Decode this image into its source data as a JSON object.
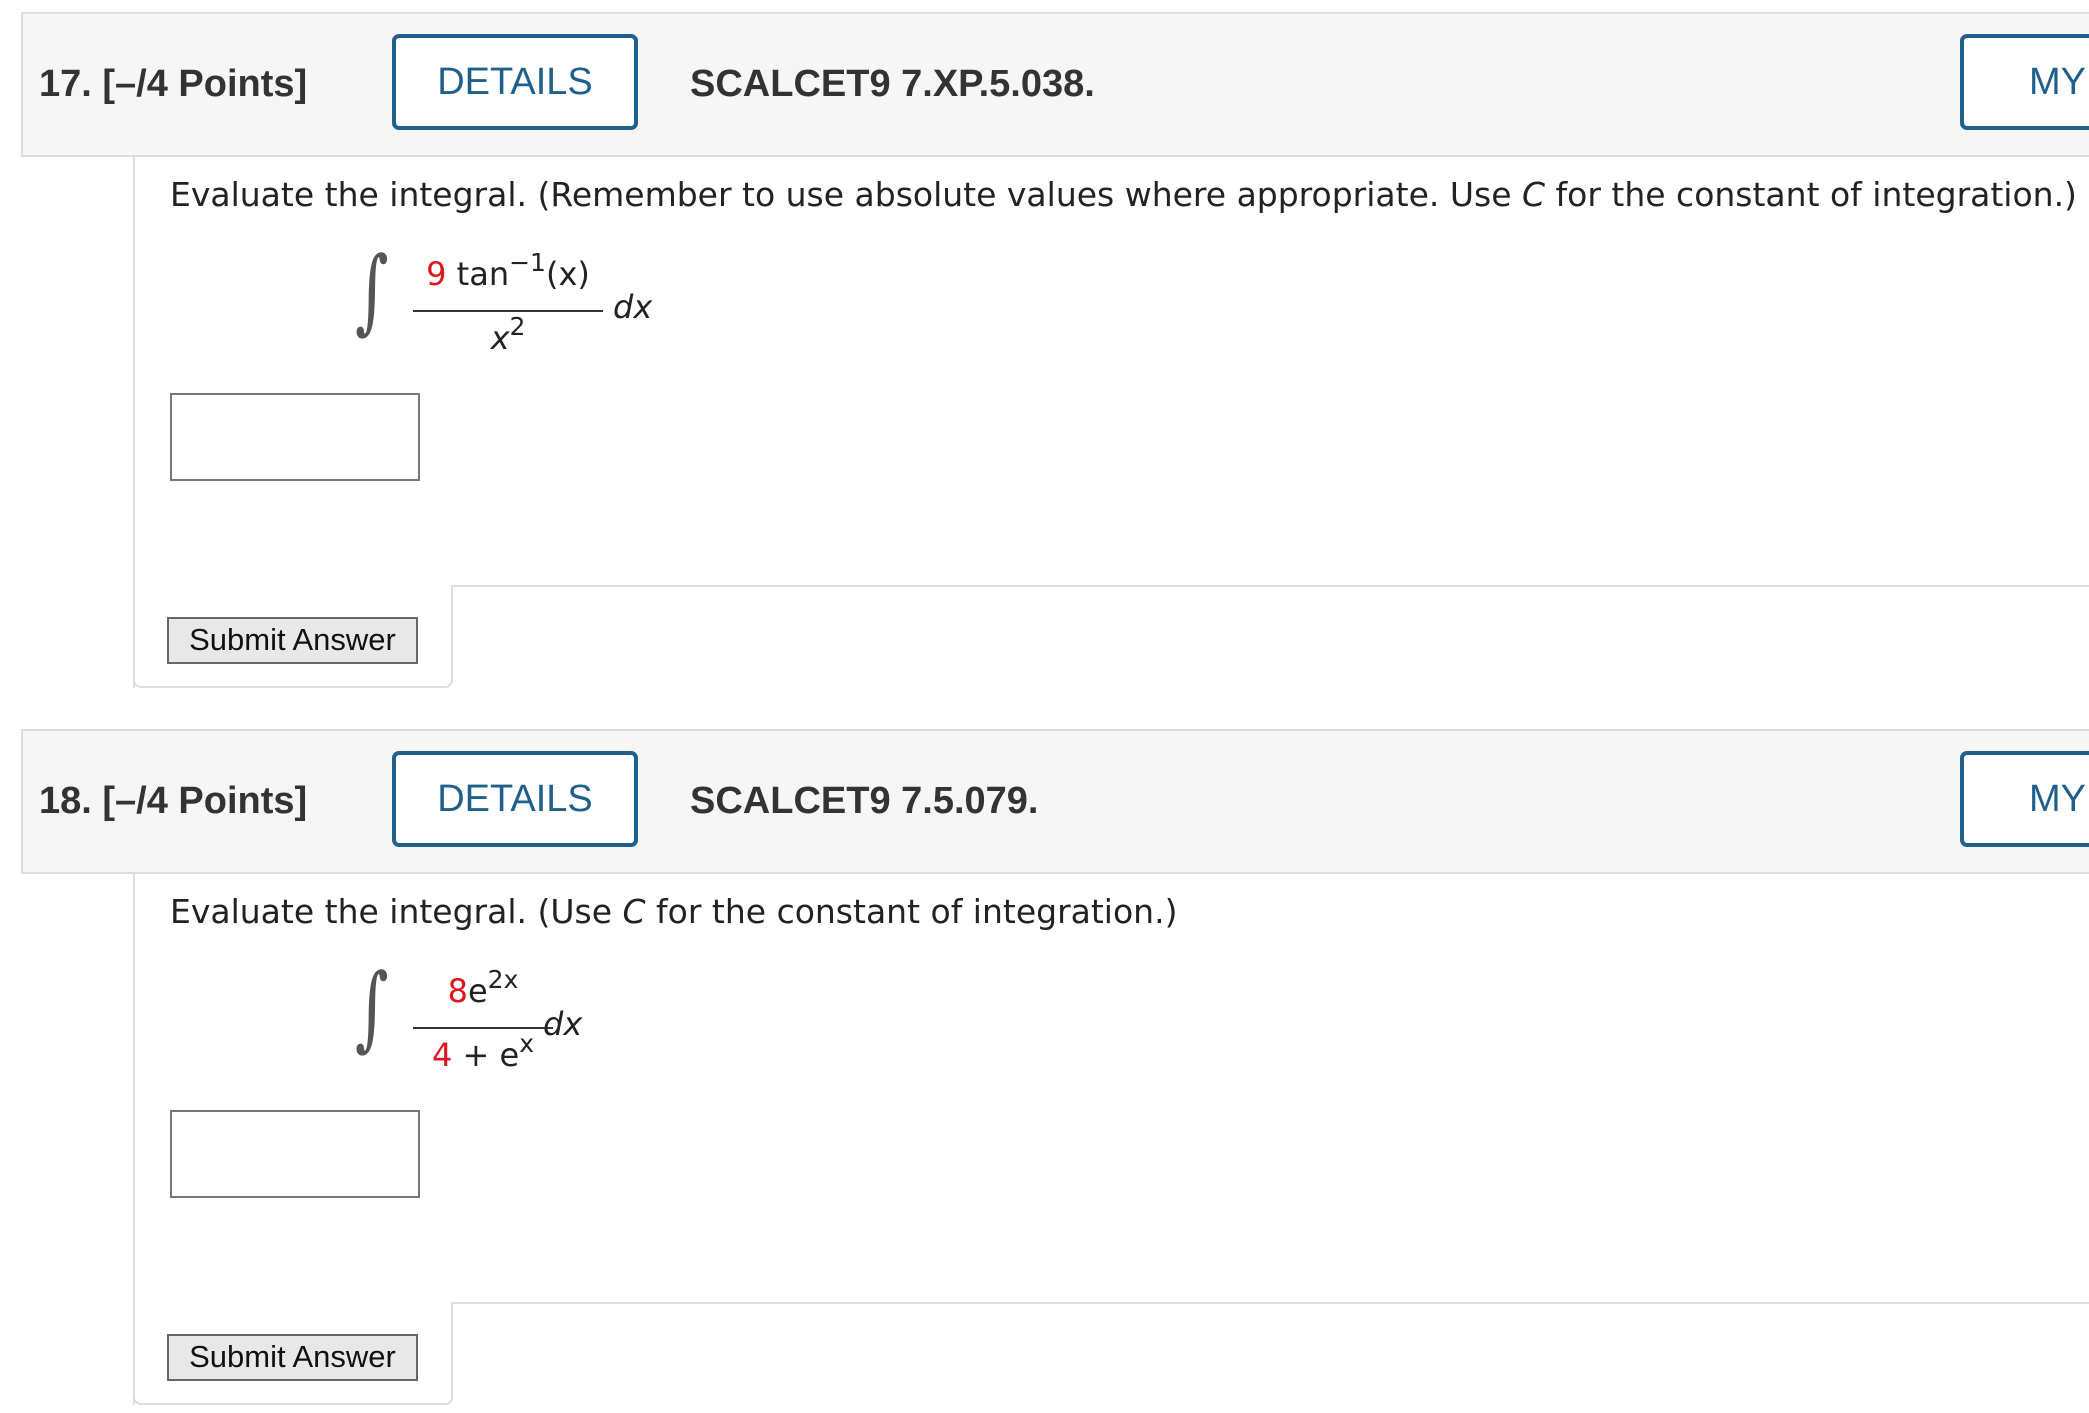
{
  "questions": [
    {
      "number_label": "17.  [–/4 Points]",
      "details_label": "DETAILS",
      "code": "SCALCET9 7.XP.5.038.",
      "my_label": "MY",
      "prompt_before": "Evaluate the integral. (Remember to use absolute values where appropriate. Use ",
      "prompt_var": "C",
      "prompt_after": " for the constant of integration.)",
      "integrand": {
        "num_coef": "9",
        "num_rest": " tan",
        "num_sup": "−1",
        "num_tail": "(x)",
        "den_base": "x",
        "den_sup": "2"
      },
      "dx": "dx",
      "answer_value": "",
      "submit_label": "Submit Answer"
    },
    {
      "number_label": "18.  [–/4 Points]",
      "details_label": "DETAILS",
      "code": "SCALCET9 7.5.079.",
      "my_label": "MY",
      "prompt_before": "Evaluate the integral. (Use ",
      "prompt_var": "C",
      "prompt_after": " for the constant of integration.)",
      "integrand": {
        "num_coef": "8",
        "num_base": "e",
        "num_sup": "2x",
        "den_coef": "4",
        "den_rest": " + e",
        "den_sup": "x"
      },
      "dx": "dx",
      "answer_value": "",
      "submit_label": "Submit Answer"
    }
  ],
  "colors": {
    "accent": "#1f5f8b",
    "highlight": "#e0141e",
    "header_bg": "#f6f6f6"
  },
  "icons": {
    "integral": "integral-sign-icon"
  }
}
